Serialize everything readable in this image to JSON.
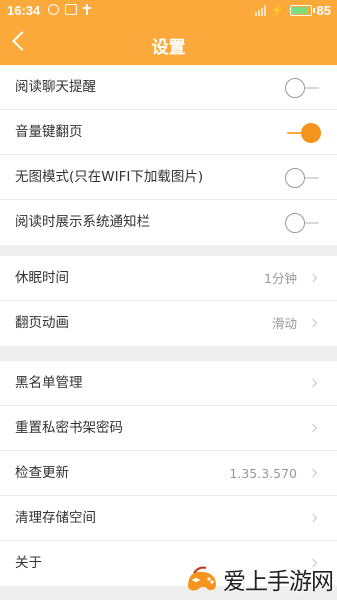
{
  "statusbar": {
    "time": "16:34",
    "battery": "85"
  },
  "appbar": {
    "title": "设置"
  },
  "groups": [
    {
      "rows": [
        {
          "label": "阅读聊天提醒",
          "toggle": false
        },
        {
          "label": "音量键翻页",
          "toggle": true
        },
        {
          "label": "无图模式(只在WIFI下加载图片)",
          "toggle": false
        },
        {
          "label": "阅读时展示系统通知栏",
          "toggle": false
        }
      ]
    },
    {
      "rows": [
        {
          "label": "休眠时间",
          "value": "1分钟"
        },
        {
          "label": "翻页动画",
          "value": "滑动"
        }
      ]
    },
    {
      "rows": [
        {
          "label": "黑名单管理",
          "value": ""
        },
        {
          "label": "重置私密书架密码",
          "value": ""
        },
        {
          "label": "检查更新",
          "value": "1.35.3.570"
        },
        {
          "label": "清理存储空间",
          "value": ""
        },
        {
          "label": "关于",
          "value": ""
        }
      ]
    }
  ],
  "watermark": {
    "text": "爱上手游网"
  },
  "colors": {
    "accent": "#fba93a",
    "toggle_on": "#f7941d"
  }
}
